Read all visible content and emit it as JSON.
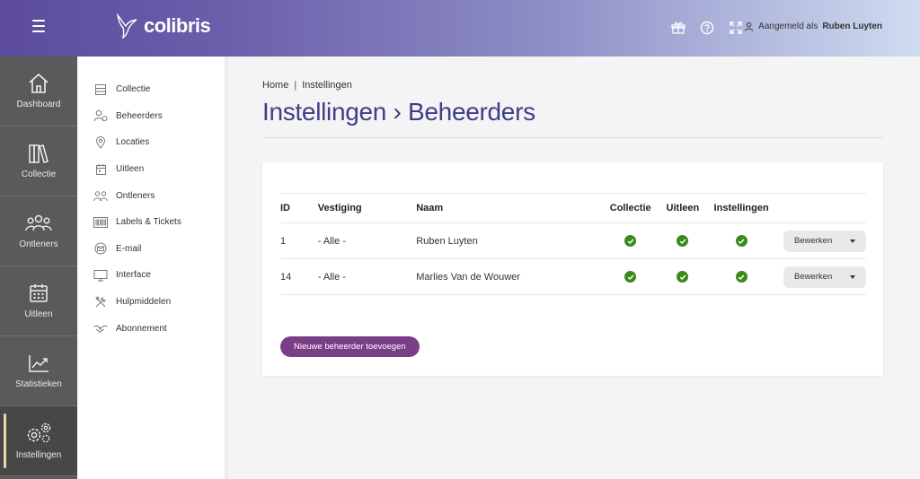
{
  "header": {
    "logo_text": "colibris",
    "user_prefix": "Aangemeld als",
    "user_name": "Ruben Luyten",
    "icons": [
      "gift-icon",
      "help-icon",
      "fullscreen-icon",
      "user-icon"
    ]
  },
  "rail": {
    "items": [
      {
        "label": "Dashboard",
        "icon": "home-icon"
      },
      {
        "label": "Collectie",
        "icon": "books-icon"
      },
      {
        "label": "Ontleners",
        "icon": "people-icon"
      },
      {
        "label": "Uitleen",
        "icon": "calendar-icon"
      },
      {
        "label": "Statistieken",
        "icon": "chart-icon"
      },
      {
        "label": "Instellingen",
        "icon": "gears-icon",
        "active": true
      }
    ]
  },
  "submenu": {
    "items": [
      {
        "label": "Collectie",
        "icon": "box-icon"
      },
      {
        "label": "Beheerders",
        "icon": "admin-user-icon"
      },
      {
        "label": "Locaties",
        "icon": "location-pin-icon"
      },
      {
        "label": "Uitleen",
        "icon": "calendar-icon"
      },
      {
        "label": "Ontleners",
        "icon": "people-icon"
      },
      {
        "label": "Labels & Tickets",
        "icon": "barcode-icon"
      },
      {
        "label": "E-mail",
        "icon": "envelope-icon"
      },
      {
        "label": "Interface",
        "icon": "monitor-icon"
      },
      {
        "label": "Hulpmiddelen",
        "icon": "tools-icon"
      },
      {
        "label": "Abonnement",
        "icon": "handshake-icon"
      }
    ]
  },
  "breadcrumb": {
    "home": "Home",
    "separator": "|",
    "current": "Instellingen"
  },
  "page_title": "Instellingen › Beheerders",
  "table": {
    "columns": [
      "ID",
      "Vestiging",
      "Naam",
      "Collectie",
      "Uitleen",
      "Instellingen"
    ],
    "rows": [
      {
        "id": "1",
        "vestiging": "- Alle -",
        "naam": "Ruben Luyten",
        "collectie": true,
        "uitleen": true,
        "instellingen": true,
        "action": "Bewerken"
      },
      {
        "id": "14",
        "vestiging": "- Alle -",
        "naam": "Marlies Van de Wouwer",
        "collectie": true,
        "uitleen": true,
        "instellingen": true,
        "action": "Bewerken"
      }
    ]
  },
  "add_button": "Nieuwe beheerder toevoegen",
  "colors": {
    "accent": "#7a3e86",
    "title": "#3d3d8a",
    "check": "#3a8a1e",
    "rail": "#5a5a5a"
  }
}
